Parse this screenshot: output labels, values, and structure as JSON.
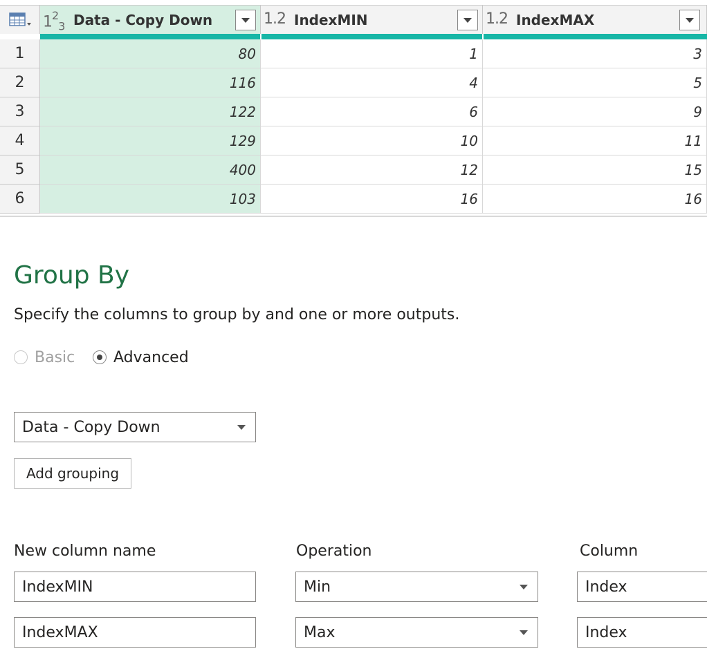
{
  "grid": {
    "columns": [
      {
        "type_icon": "whole-number-type-icon",
        "type_main": "1",
        "type_sup": "2",
        "type_sub": "3",
        "label": "Data - Copy Down"
      },
      {
        "type_icon": "decimal-type-icon",
        "type_text": "1.2",
        "label": "IndexMIN"
      },
      {
        "type_icon": "decimal-type-icon",
        "type_text": "1.2",
        "label": "IndexMAX"
      }
    ],
    "rows": [
      {
        "num": "1",
        "c1": "80",
        "c2": "1",
        "c3": "3"
      },
      {
        "num": "2",
        "c1": "116",
        "c2": "4",
        "c3": "5"
      },
      {
        "num": "3",
        "c1": "122",
        "c2": "6",
        "c3": "9"
      },
      {
        "num": "4",
        "c1": "129",
        "c2": "10",
        "c3": "11"
      },
      {
        "num": "5",
        "c1": "400",
        "c2": "12",
        "c3": "15"
      },
      {
        "num": "6",
        "c1": "103",
        "c2": "16",
        "c3": "16"
      }
    ],
    "colors": {
      "selected_column": "#d6efe2",
      "quality_bar": "#17b6a6"
    }
  },
  "dialog": {
    "title": "Group By",
    "description": "Specify the columns to group by and one or more outputs.",
    "mode_basic": "Basic",
    "mode_advanced": "Advanced",
    "selected_mode": "Advanced",
    "group_by_column": "Data - Copy Down",
    "add_grouping_label": "Add grouping",
    "headers": {
      "new_column_name": "New column name",
      "operation": "Operation",
      "column": "Column"
    },
    "aggregations": [
      {
        "name": "IndexMIN",
        "operation": "Min",
        "column": "Index"
      },
      {
        "name": "IndexMAX",
        "operation": "Max",
        "column": "Index"
      }
    ],
    "title_color": "#217346"
  }
}
